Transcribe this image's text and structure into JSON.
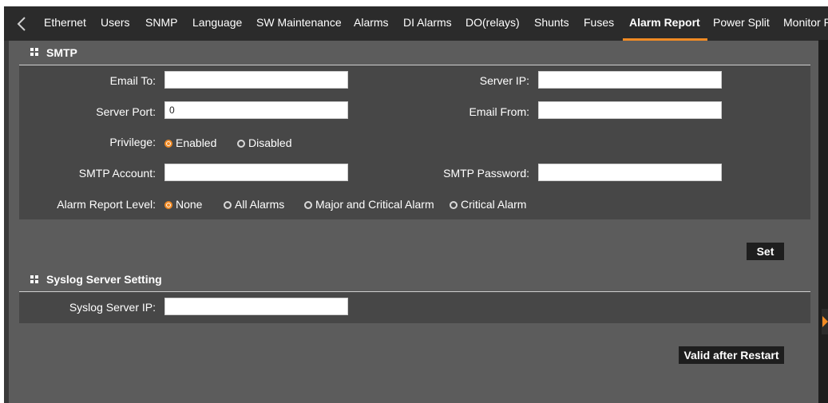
{
  "tabs": [
    {
      "label": "Ethernet"
    },
    {
      "label": "Users"
    },
    {
      "label": "SNMP"
    },
    {
      "label": "Language"
    },
    {
      "label": "SW Maintenance"
    },
    {
      "label": "Alarms"
    },
    {
      "label": "DI Alarms"
    },
    {
      "label": "DO(relays)"
    },
    {
      "label": "Shunts"
    },
    {
      "label": "Fuses"
    },
    {
      "label": "Alarm Report",
      "active": true
    },
    {
      "label": "Power Split"
    },
    {
      "label": "Monitor P"
    }
  ],
  "smtp": {
    "title": "SMTP",
    "email_to": {
      "label": "Email To:",
      "value": ""
    },
    "server_ip": {
      "label": "Server IP:",
      "value": ""
    },
    "server_port": {
      "label": "Server Port:",
      "value": "0"
    },
    "email_from": {
      "label": "Email From:",
      "value": ""
    },
    "privilege": {
      "label": "Privilege:",
      "options": [
        {
          "label": "Enabled",
          "checked": true
        },
        {
          "label": "Disabled",
          "checked": false
        }
      ]
    },
    "smtp_account": {
      "label": "SMTP Account:",
      "value": ""
    },
    "smtp_password": {
      "label": "SMTP Password:",
      "value": ""
    },
    "alarm_report_level": {
      "label": "Alarm Report Level:",
      "options": [
        {
          "label": "None",
          "checked": true
        },
        {
          "label": "All Alarms",
          "checked": false
        },
        {
          "label": "Major and Critical Alarm",
          "checked": false
        },
        {
          "label": "Critical Alarm",
          "checked": false
        }
      ]
    },
    "set_button": "Set"
  },
  "syslog": {
    "title": "Syslog Server Setting",
    "server_ip": {
      "label": "Syslog Server IP:",
      "value": ""
    },
    "button": "Valid after Restart"
  },
  "colors": {
    "accent": "#f08a24",
    "tabbar": "#2b2b2b",
    "background": "#5c5c5c",
    "panel": "#474747"
  },
  "icons": {
    "back": "chevron-left-icon",
    "section": "grid-icon",
    "rail": "triangle-right-icon"
  }
}
